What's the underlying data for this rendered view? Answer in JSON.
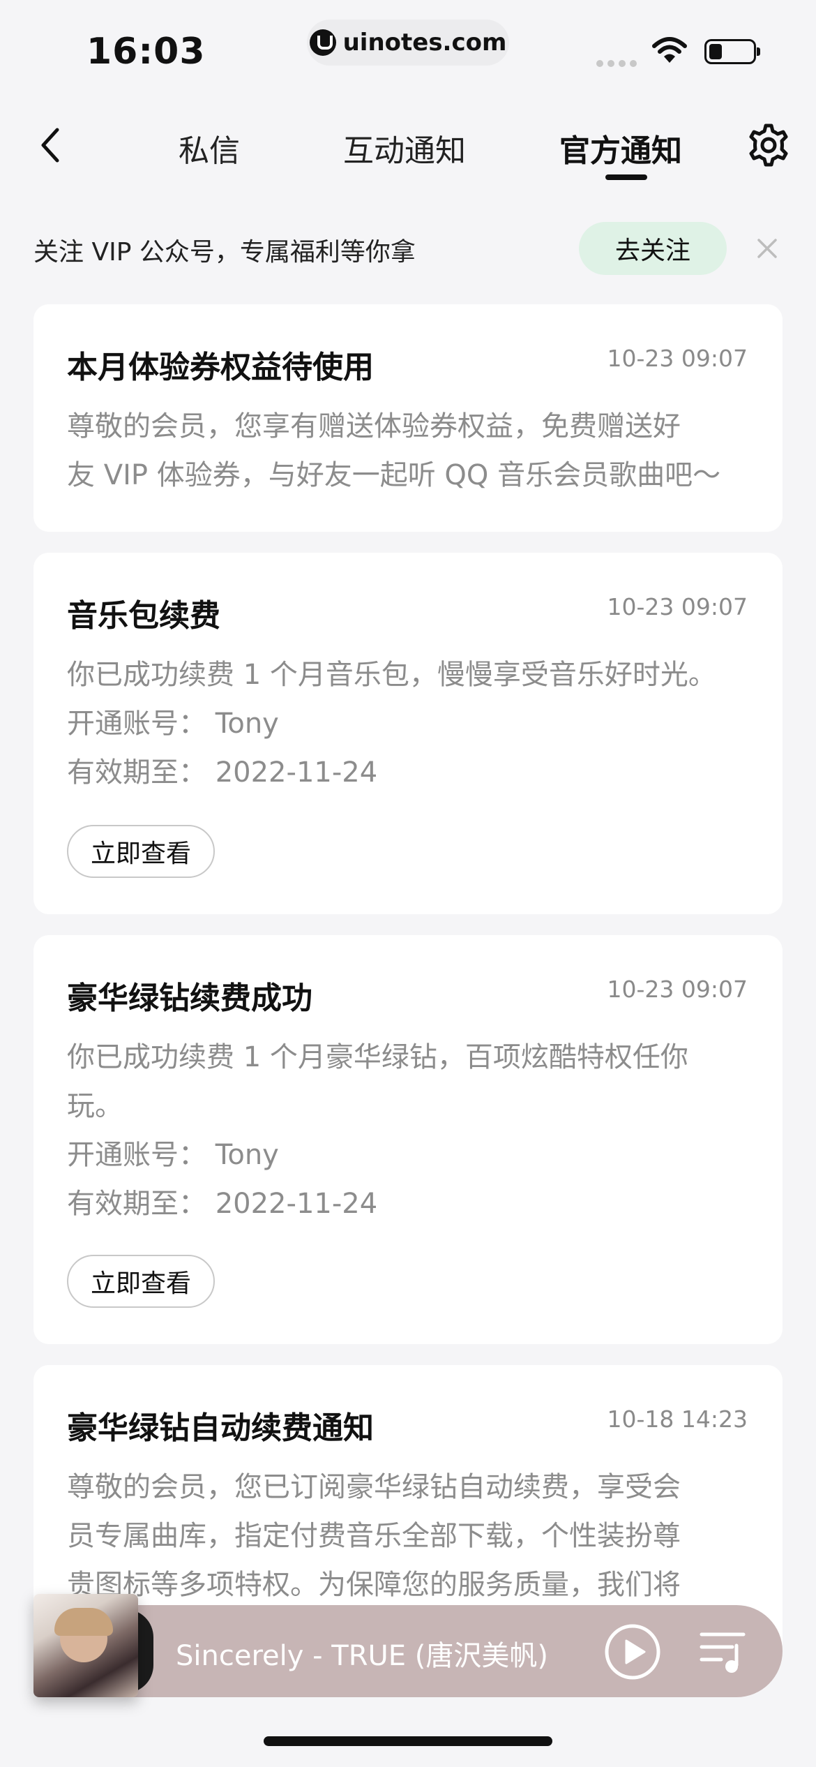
{
  "status_bar": {
    "time": "16:03",
    "url": "uinotes.com",
    "icons": [
      "signal-icon",
      "wifi-icon",
      "battery-icon"
    ]
  },
  "nav": {
    "tabs": [
      {
        "label": "私信",
        "active": false
      },
      {
        "label": "互动通知",
        "active": false
      },
      {
        "label": "官方通知",
        "active": true
      }
    ],
    "icons": [
      "back-icon",
      "settings-icon"
    ]
  },
  "follow_banner": {
    "text": "关注 VIP 公众号，专属福利等你拿",
    "button": "去关注",
    "accent": "#dff2e6"
  },
  "notifications": [
    {
      "title": "本月体验券权益待使用",
      "time": "10-23 09:07",
      "lines": [
        "尊敬的会员，您享有赠送体验券权益，免费赠送好",
        "友 VIP 体验券，与好友一起听 QQ 音乐会员歌曲吧～"
      ]
    },
    {
      "title": "音乐包续费",
      "time": "10-23 09:07",
      "lines": [
        "你已成功续费 1 个月音乐包，慢慢享受音乐好时光。",
        "开通账号：  Tony",
        "有效期至：  2022-11-24"
      ],
      "button": "立即查看"
    },
    {
      "title": "豪华绿钻续费成功",
      "time": "10-23 09:07",
      "lines": [
        "你已成功续费 1 个月豪华绿钻，百项炫酷特权任你",
        "玩。",
        "开通账号：  Tony",
        "有效期至：  2022-11-24"
      ],
      "button": "立即查看"
    },
    {
      "title": "豪华绿钻自动续费通知",
      "time": "10-18 14:23",
      "lines": [
        "尊敬的会员，您已订阅豪华绿钻自动续费，享受会",
        "员专属曲库，指定付费音乐全部下载，个性装扮尊",
        "贵图标等多项特权。为保障您的服务质量，我们将"
      ]
    }
  ],
  "player": {
    "song": "Sincerely - TRUE (唐沢美帆)",
    "icons": [
      "play-icon",
      "playlist-icon"
    ],
    "bar_color": "#c7b5b5"
  }
}
